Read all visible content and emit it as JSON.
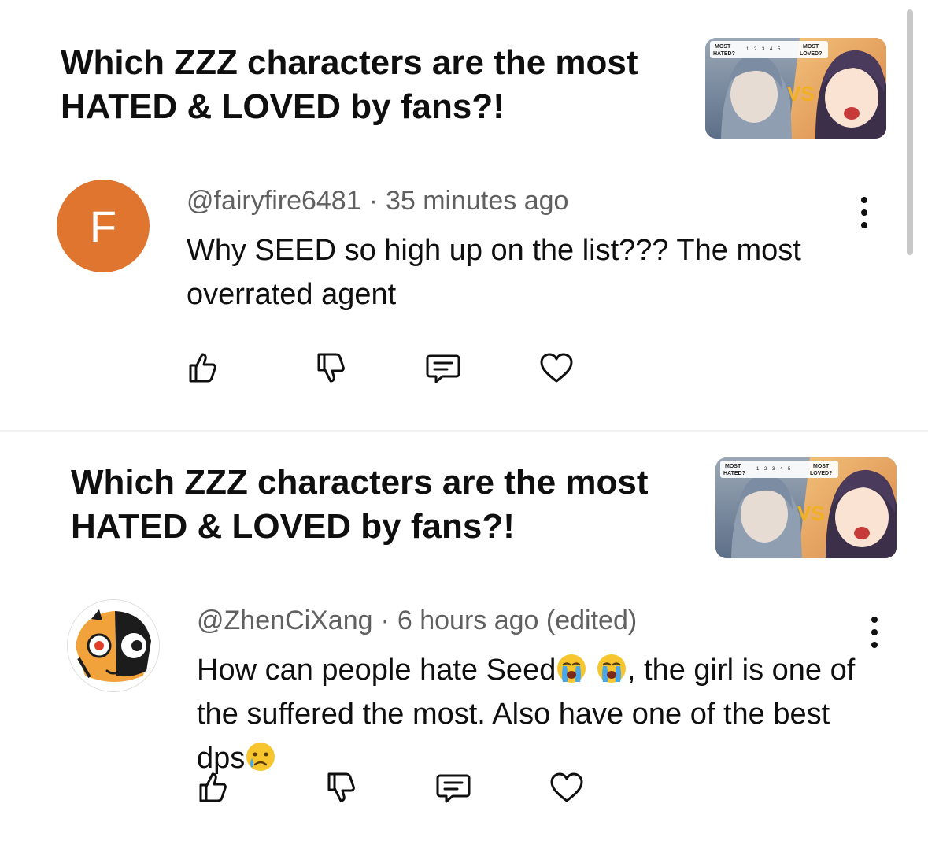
{
  "comments": [
    {
      "video_title": "Which ZZZ characters are the most HATED & LOVED by fans?!",
      "thumbnail": {
        "label_left": "MOST HATED?",
        "label_right": "MOST LOVED?",
        "scale": [
          "1",
          "2",
          "3",
          "4",
          "5"
        ],
        "vs_text": "VS"
      },
      "author": "@fairyfire6481",
      "time": "35 minutes ago",
      "edited": "",
      "text": "Why SEED so high up on the list??? The most overrated agent",
      "avatar_letter": "F",
      "avatar_color": "#e07530",
      "icons": [
        "like-icon",
        "dislike-icon",
        "reply-icon",
        "heart-icon",
        "more-vertical-icon"
      ]
    },
    {
      "video_title": "Which ZZZ characters are the most HATED & LOVED by fans?!",
      "thumbnail": {
        "label_left": "MOST HATED?",
        "label_right": "MOST LOVED?",
        "scale": [
          "1",
          "2",
          "3",
          "4",
          "5"
        ],
        "vs_text": "VS"
      },
      "author": "@ZhenCiXang",
      "time": "6 hours ago",
      "edited": "(edited)",
      "text_part1": "How can people hate Seed",
      "text_part2": ", the girl is one of the suffered the most. Also have one of the best dps",
      "emojis": [
        "loudly-crying-emoji",
        "loudly-crying-emoji",
        "sad-but-relieved-emoji"
      ],
      "icons": [
        "like-icon",
        "dislike-icon",
        "reply-icon",
        "heart-icon",
        "more-vertical-icon"
      ]
    }
  ],
  "separator": "·"
}
